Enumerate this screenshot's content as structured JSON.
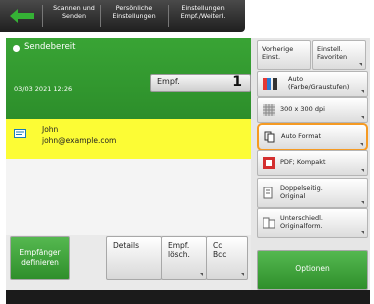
{
  "header": {
    "tab1": "Scannen und\nSenden",
    "tab2": "Persönliche\nEinstellungen",
    "tab3": "Einstellungen\nEmpf./Weiterl."
  },
  "status": {
    "text": "Sendebereit",
    "datetime": "03/03 2021 12:26"
  },
  "destination": {
    "label": "Empf.",
    "count": "1"
  },
  "contacts": [
    {
      "name": "John",
      "email": "john@example.com"
    }
  ],
  "right_panel": {
    "prev_settings": "Vorherige\nEinst.",
    "favorites": "Einstell.\nFavoriten",
    "color_mode": "Auto\n(Farbe/Graustufen)",
    "resolution": "300 x 300 dpi",
    "file_format": "Auto Format",
    "pdf": "PDF; Kompakt",
    "duplex": "Doppelseitig.\nOriginal",
    "different_sizes": "Unterschiedl.\nOriginalform."
  },
  "bottom": {
    "define_recipient": "Empfänger\ndefinieren",
    "details": "Details",
    "delete_recipient": "Empf.\nlösch.",
    "cc_bcc": "Cc\nBcc",
    "options": "Optionen"
  },
  "colors": {
    "accent_green": "#33a031",
    "selection_yellow": "#fcfc35",
    "highlight_orange": "#f59a23"
  }
}
